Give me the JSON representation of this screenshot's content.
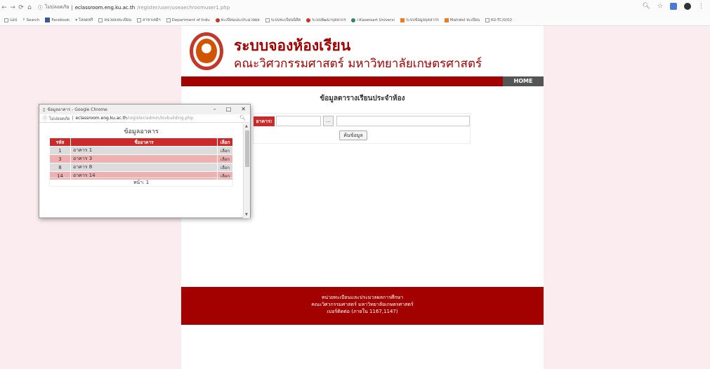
{
  "browser": {
    "url_info": "ไม่ปลอดภัย",
    "url_host": "eclassroom.eng.ku.ac.th",
    "url_path": "/register/user/useaechroomuser1.php",
    "bookmarks": [
      "แอป",
      "Search",
      "Facebook",
      "โหลดฟรี",
      "หน่วยลงทะเบียน",
      "สาขาเคมีฯ",
      "Department of Indu",
      "ทะเบียนและประมวลผล",
      "ระบบทะเบียนนิสิต",
      "ระบบพัฒนาบุคลากร",
      "i-Kasetsart Universi",
      "ระบบข้อมูลบุคลากร",
      "Mahidol ทะเบียน",
      "KU-TC/0/02"
    ]
  },
  "header": {
    "title_line1": "ระบบจองห้องเรียน",
    "title_line2": "คณะวิศวกรรมศาสตร์ มหาวิทยาลัยเกษตรศาสตร์"
  },
  "nav": {
    "home_label": "HOME"
  },
  "main": {
    "subtitle": "ข้อมูลตารางเรียนประจำห้อง",
    "building_label": "อาคาร:",
    "browse_label": "...",
    "search_label": "ค้นข้อมูล"
  },
  "footer": {
    "line1": "หน่วยทะเบียนและประมวลผลการศึกษา",
    "line2": "คณะวิศวกรรมศาสตร์ มหาวิทยาลัยเกษตรศาสตร์",
    "line3": "เบอร์ติดต่อ (ภายใน 1167,1147)"
  },
  "popup": {
    "window_title": "ข้อมูลอาคาร - Google Chrome",
    "url_info": "ไม่ปลอดภัย",
    "url_host": "eclassroom.eng.ku.ac.th",
    "url_path": "/register/admin/lovbuilding.php",
    "heading": "ข้อมูลอาคาร",
    "columns": [
      "รหัส",
      "ชื่ออาคาร",
      "เลือก"
    ],
    "rows": [
      {
        "id": "1",
        "name": "อาคาร 1",
        "action": "เลือก"
      },
      {
        "id": "3",
        "name": "อาคาร 3",
        "action": "เลือก"
      },
      {
        "id": "8",
        "name": "อาคาร 8",
        "action": "เลือก"
      },
      {
        "id": "14",
        "name": "อาคาร 14",
        "action": "เลือก"
      }
    ],
    "pager": "หน้า: 1"
  },
  "colors": {
    "brand": "#a30000",
    "accent": "#cc2a2a",
    "background": "#fbecef"
  }
}
